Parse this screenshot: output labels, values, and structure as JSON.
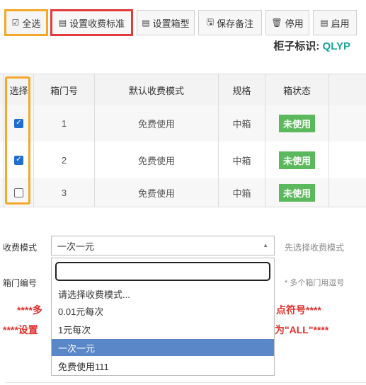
{
  "toolbar": {
    "select_all": "全选",
    "set_fee_standard": "设置收费标准",
    "set_box_type": "设置箱型",
    "save_remark": "保存备注",
    "disable": "停用",
    "enable": "启用"
  },
  "cabinet": {
    "label": "柜子标识:",
    "code": "QLYP"
  },
  "table": {
    "headers": [
      "选择",
      "箱门号",
      "默认收费模式",
      "规格",
      "箱状态"
    ],
    "rows": [
      {
        "checked": true,
        "door": "1",
        "mode": "免费使用",
        "size": "中箱",
        "status": "未使用"
      },
      {
        "checked": true,
        "door": "2",
        "mode": "免费使用",
        "size": "中箱",
        "status": "未使用"
      },
      {
        "checked": false,
        "door": "3",
        "mode": "免费使用",
        "size": "中箱",
        "status": "未使用"
      }
    ]
  },
  "form": {
    "fee_mode_label": "收费模式",
    "fee_mode_value": "一次一元",
    "fee_mode_hint": "先选择收费模式",
    "door_no_label": "箱门编号",
    "door_no_hint": "* 多个箱门用逗号",
    "options": [
      "请选择收费模式...",
      "0.01元每次",
      "1元每次",
      "一次一元",
      "免费使用111"
    ],
    "selected_option": "一次一元",
    "warn1_left": "****多",
    "warn1_right": "点符号****",
    "warn2_left": "****设置",
    "warn2_right": "为\"ALL\"****"
  },
  "colors": {
    "accent_status": "#5cb85c",
    "checkbox": "#1f6fd0",
    "highlight_orange": "#f3a829",
    "highlight_red": "#e23b3b",
    "option_selected": "#5a87c8",
    "warning": "#e0302c",
    "cabinet_code": "#18a59a"
  }
}
